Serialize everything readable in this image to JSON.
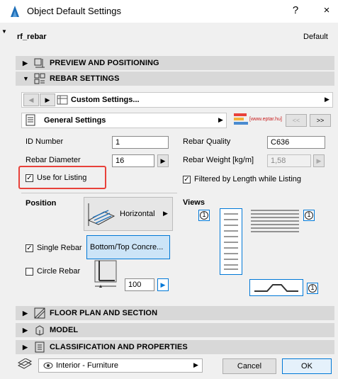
{
  "window": {
    "title": "Object Default Settings",
    "help_label": "?",
    "close_label": "×"
  },
  "header": {
    "object_name": "rf_rebar",
    "default_label": "Default"
  },
  "sections": {
    "preview": "PREVIEW AND POSITIONING",
    "rebar": "REBAR SETTINGS",
    "floor_plan": "FLOOR PLAN AND SECTION",
    "model": "MODEL",
    "classification": "CLASSIFICATION AND PROPERTIES"
  },
  "custom_settings": {
    "label": "Custom Settings..."
  },
  "general": {
    "label": "General Settings",
    "brand_text": "[www.eptar.hu]",
    "prev_label": "<<",
    "next_label": ">>"
  },
  "fields": {
    "id_number": {
      "label": "ID Number",
      "value": "1"
    },
    "rebar_diameter": {
      "label": "Rebar Diameter",
      "value": "16"
    },
    "rebar_quality": {
      "label": "Rebar Quality",
      "value": "C636"
    },
    "rebar_weight": {
      "label": "Rebar Weight [kg/m]",
      "value": "1,58"
    },
    "use_for_listing": {
      "label": "Use for Listing",
      "checked": true
    },
    "filtered_by_length": {
      "label": "Filtered by Length while Listing",
      "checked": true
    },
    "single_rebar": {
      "label": "Single Rebar",
      "checked": true
    },
    "circle_rebar": {
      "label": "Circle Rebar",
      "checked": false
    },
    "circle_value": "100"
  },
  "position": {
    "label": "Position",
    "mode": "Horizontal",
    "bottom_top": "Bottom/Top Concre..."
  },
  "views": {
    "label": "Views",
    "badge": "1"
  },
  "footer": {
    "layer": "Interior - Furniture",
    "cancel": "Cancel",
    "ok": "OK"
  },
  "colors": {
    "highlight": "#e8413a",
    "accent_blue": "#0078d7",
    "section_bg": "#d8d8d8"
  }
}
